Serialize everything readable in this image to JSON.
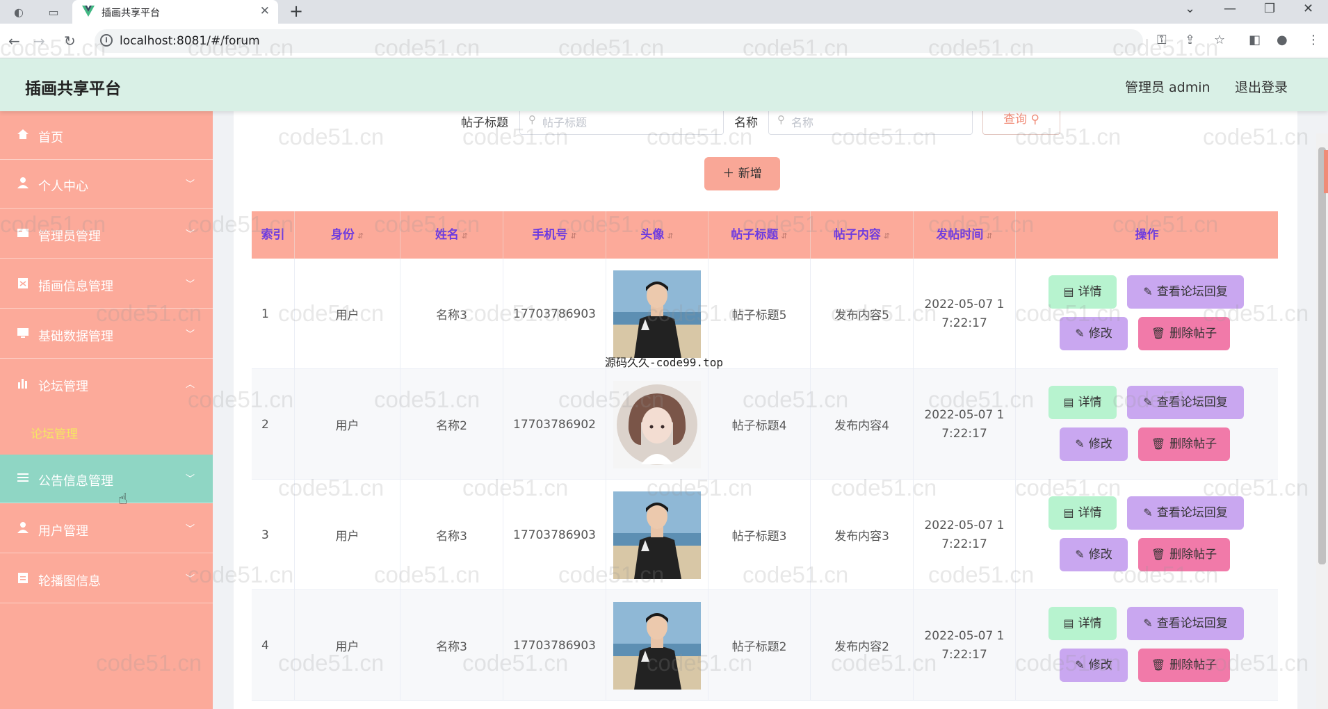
{
  "browser": {
    "tab_title": "插画共享平台",
    "url": "localhost:8081/#/forum"
  },
  "header": {
    "title": "插画共享平台",
    "user": "管理员 admin",
    "logout": "退出登录"
  },
  "sidebar": {
    "items": [
      {
        "label": "首页",
        "icon": "home-icon"
      },
      {
        "label": "个人中心",
        "icon": "user-icon"
      },
      {
        "label": "管理员管理",
        "icon": "admin-icon"
      },
      {
        "label": "插画信息管理",
        "icon": "clipboard-icon"
      },
      {
        "label": "基础数据管理",
        "icon": "monitor-icon"
      },
      {
        "label": "论坛管理",
        "icon": "chart-icon"
      },
      {
        "label": "公告信息管理",
        "icon": "list-icon"
      },
      {
        "label": "用户管理",
        "icon": "user-icon"
      },
      {
        "label": "轮播图信息",
        "icon": "clipboard-icon"
      }
    ],
    "active_submenu": "论坛管理"
  },
  "search": {
    "title_label": "帖子标题",
    "title_placeholder": "帖子标题",
    "name_label": "名称",
    "name_placeholder": "名称",
    "query_button": "查询"
  },
  "add_button": "新增",
  "table": {
    "columns": [
      "索引",
      "身份",
      "姓名",
      "手机号",
      "头像",
      "帖子标题",
      "帖子内容",
      "发帖时间",
      "操作"
    ],
    "rows": [
      {
        "index": "1",
        "identity": "用户",
        "name": "名称3",
        "phone": "17703786903",
        "avatar": "boy",
        "title": "帖子标题5",
        "content": "发布内容5",
        "time_line1": "2022-05-07 1",
        "time_line2": "7:22:17"
      },
      {
        "index": "2",
        "identity": "用户",
        "name": "名称2",
        "phone": "17703786902",
        "avatar": "girl",
        "title": "帖子标题4",
        "content": "发布内容4",
        "time_line1": "2022-05-07 1",
        "time_line2": "7:22:17"
      },
      {
        "index": "3",
        "identity": "用户",
        "name": "名称3",
        "phone": "17703786903",
        "avatar": "boy",
        "title": "帖子标题3",
        "content": "发布内容3",
        "time_line1": "2022-05-07 1",
        "time_line2": "7:22:17"
      },
      {
        "index": "4",
        "identity": "用户",
        "name": "名称3",
        "phone": "17703786903",
        "avatar": "boy",
        "title": "帖子标题2",
        "content": "发布内容2",
        "time_line1": "2022-05-07 1",
        "time_line2": "7:22:17"
      }
    ],
    "actions": {
      "detail": "详情",
      "reply": "查看论坛回复",
      "edit": "修改",
      "delete": "删除帖子"
    }
  },
  "overlay_text": "源码久久-code99.top",
  "watermark": "code51.cn",
  "colors": {
    "header_bg": "#d9f0e6",
    "sidebar_bg": "#fcaa9a",
    "sidebar_active": "#8fd6c4",
    "table_header_bg": "#fcaa9a",
    "table_header_text": "#6d3be0"
  }
}
